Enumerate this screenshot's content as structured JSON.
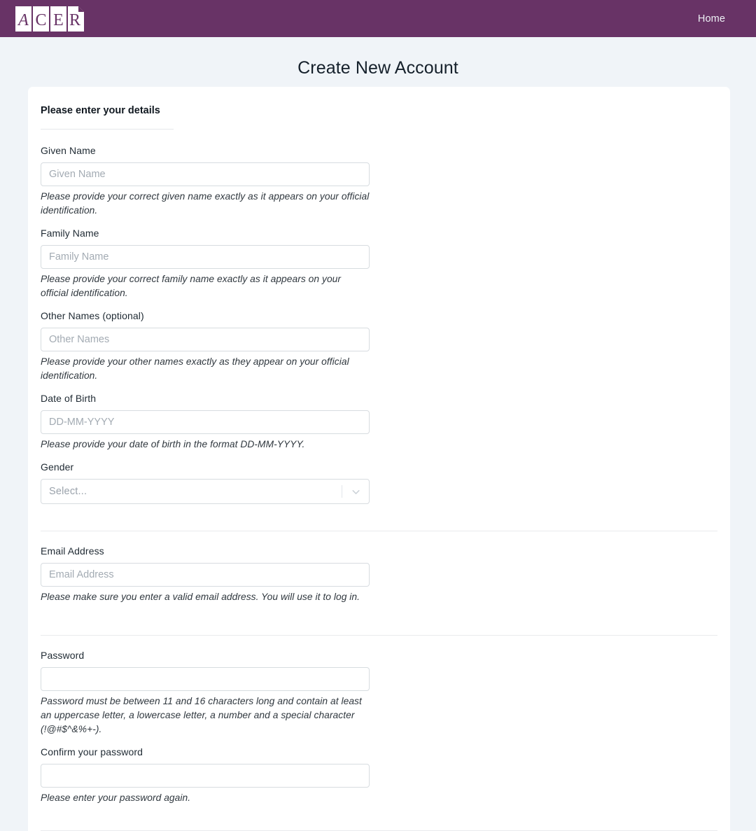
{
  "header": {
    "logo_alt": "ACER",
    "logo_letters": [
      "A",
      "C",
      "E",
      "R"
    ],
    "nav": [
      {
        "label": "Home",
        "name": "nav-home"
      }
    ],
    "bar_color": "#683366"
  },
  "page": {
    "title": "Create New Account",
    "background_color": "#f0f4f8"
  },
  "form": {
    "section_heading": "Please enter your details",
    "fields": {
      "given_name": {
        "label": "Given Name",
        "placeholder": "Given Name",
        "value": "",
        "help": "Please provide your correct given name exactly as it appears on your official identification."
      },
      "family_name": {
        "label": "Family Name",
        "placeholder": "Family Name",
        "value": "",
        "help": "Please provide your correct family name exactly as it appears on your official identification."
      },
      "other_names": {
        "label": "Other Names (optional)",
        "placeholder": "Other Names",
        "value": "",
        "help": "Please provide your other names exactly as they appear on your official identification."
      },
      "date_of_birth": {
        "label": "Date of Birth",
        "placeholder": "DD-MM-YYYY",
        "value": "",
        "help": "Please provide your date of birth in the format DD-MM-YYYY."
      },
      "gender": {
        "label": "Gender",
        "selected": "Select...",
        "dropdown_icon": "chevron-down-icon"
      },
      "email": {
        "label": "Email Address",
        "placeholder": "Email Address",
        "value": "",
        "help": "Please make sure you enter a valid email address. You will use it to log in."
      },
      "password": {
        "label": "Password",
        "placeholder": "",
        "value": "",
        "help": "Password must be between 11 and 16 characters long and contain at least an uppercase letter, a lowercase letter, a number and a special character (!@#$^&%+-)."
      },
      "confirm_password": {
        "label": "Confirm your password",
        "placeholder": "",
        "value": "",
        "help": "Please enter your password again."
      }
    }
  }
}
